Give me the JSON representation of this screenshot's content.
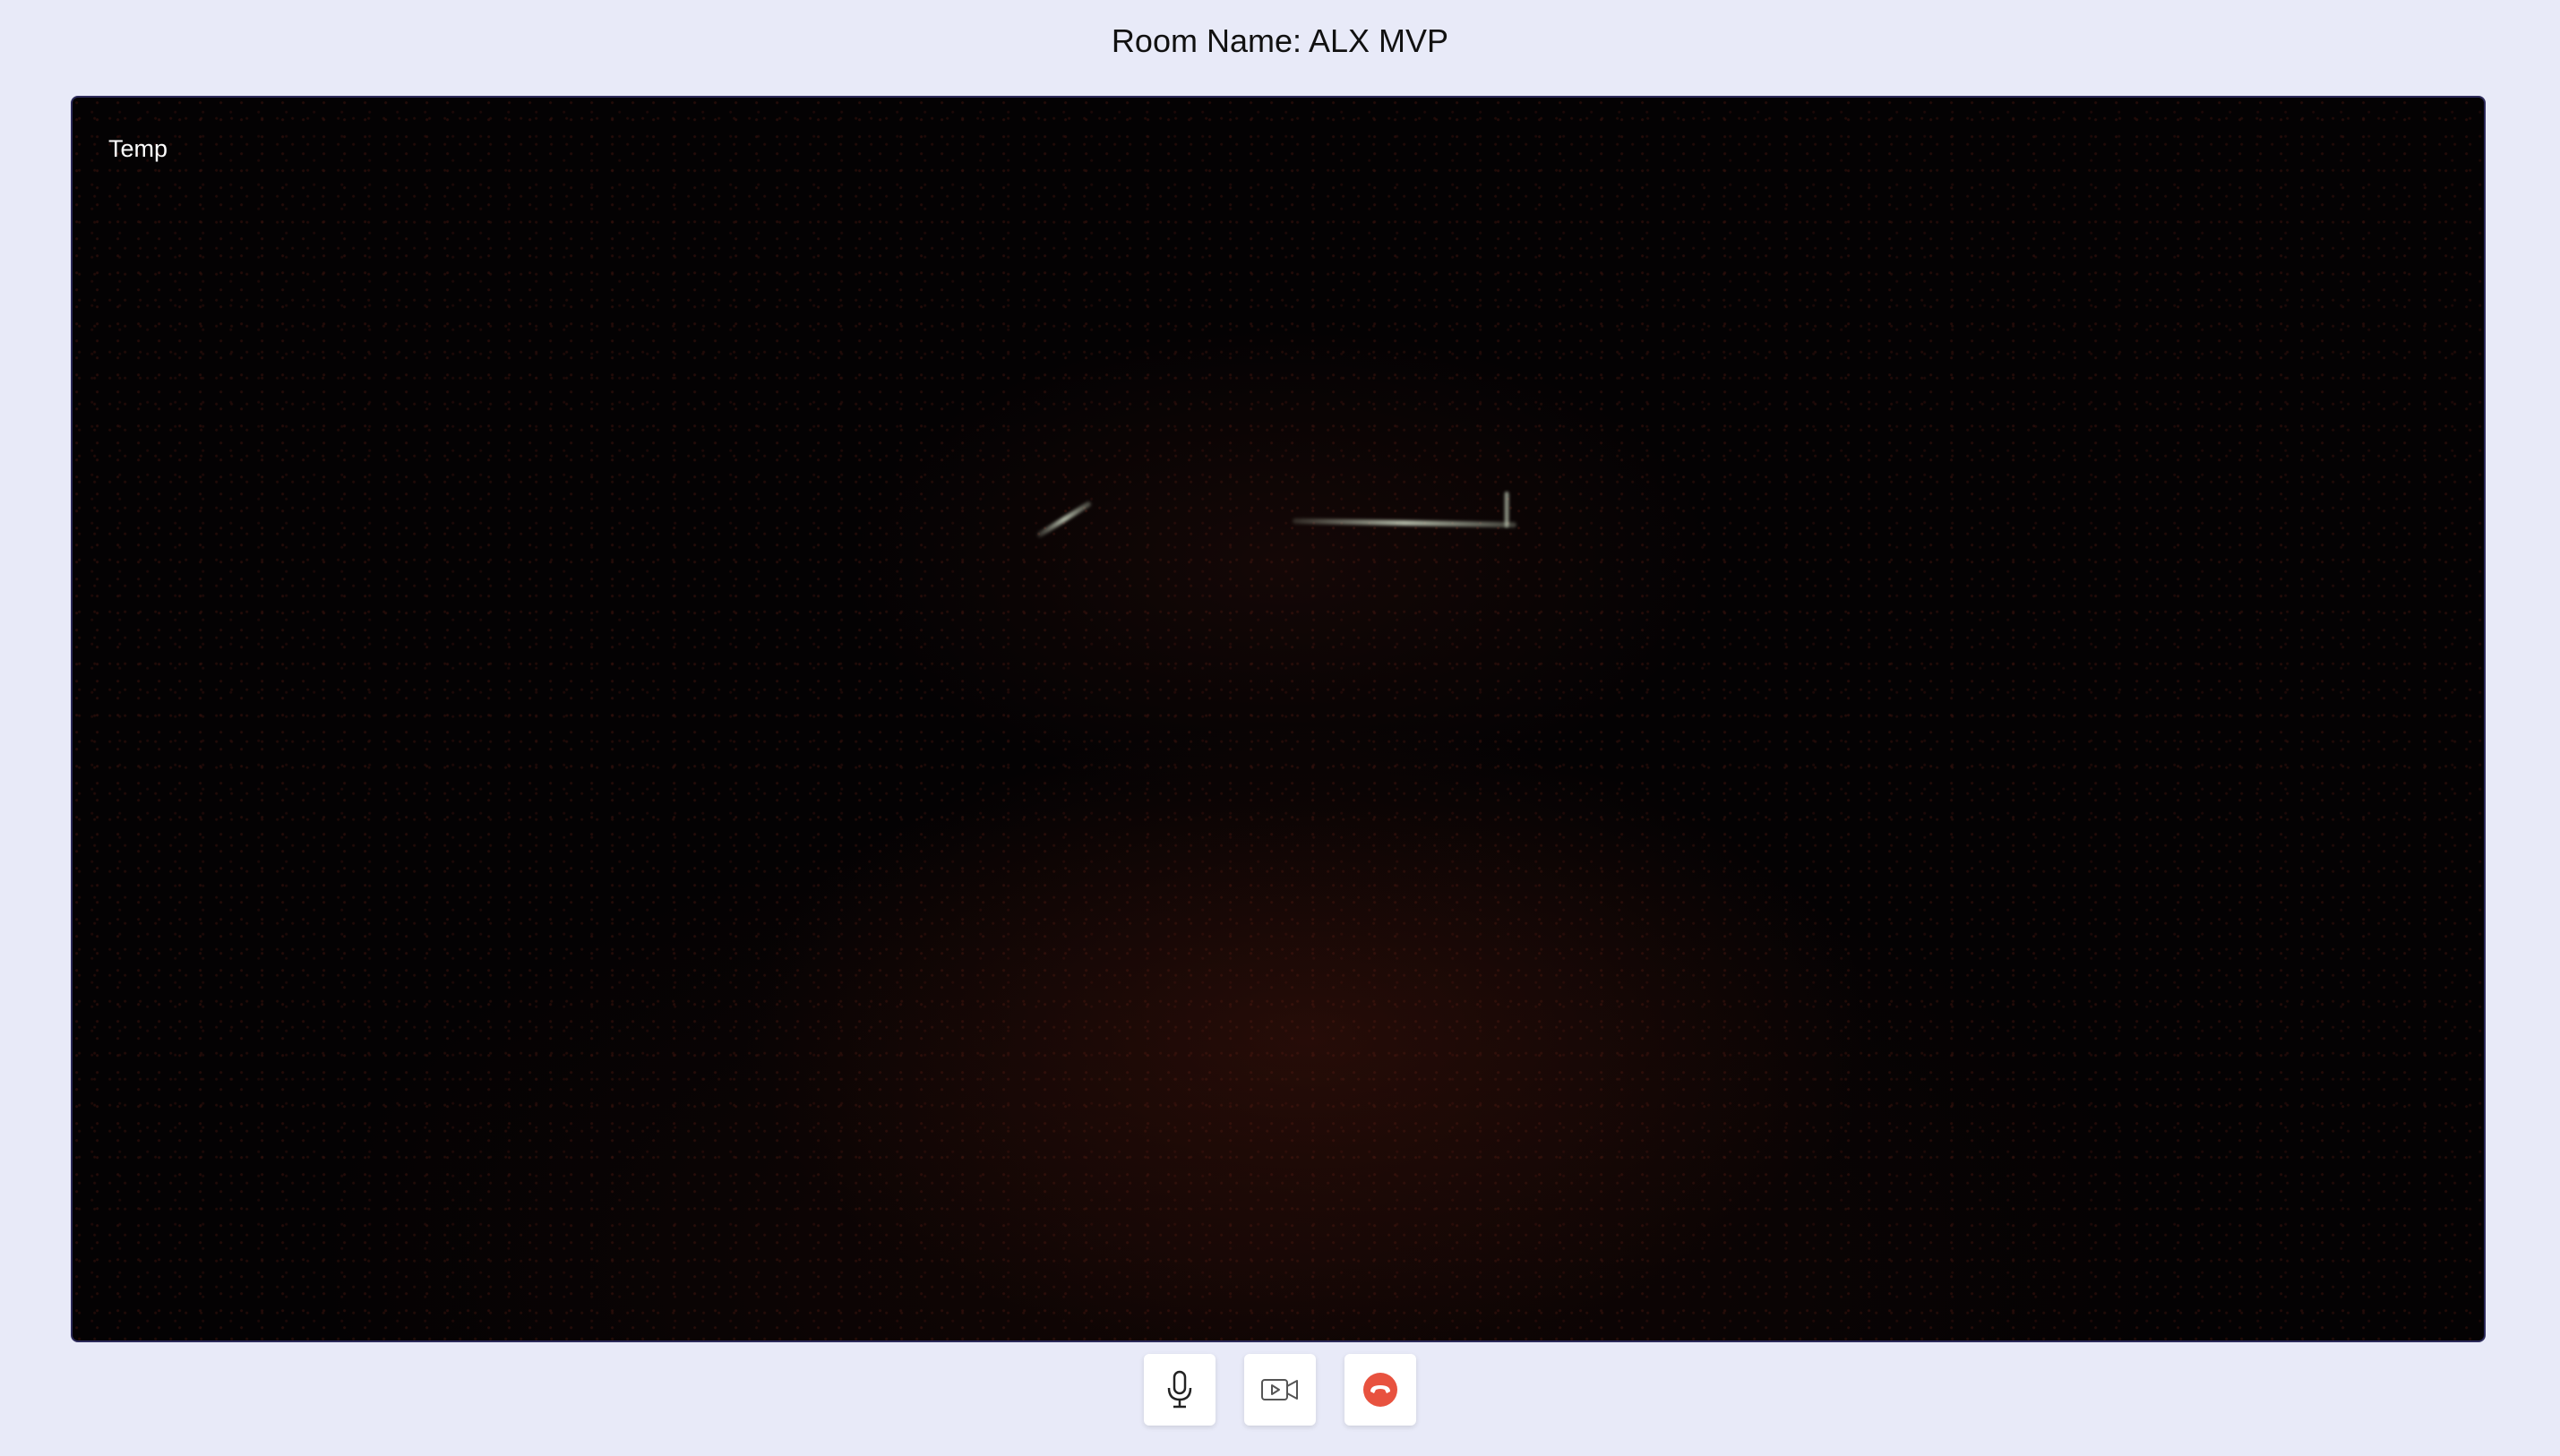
{
  "header": {
    "room_title": "Room Name: ALX MVP"
  },
  "video": {
    "participant_name": "Temp"
  },
  "controls": {
    "buttons": [
      {
        "icon": "microphone-icon",
        "action": "toggle-mic"
      },
      {
        "icon": "video-camera-icon",
        "action": "toggle-camera"
      },
      {
        "icon": "end-call-icon",
        "action": "hang-up",
        "color": "#e8523f"
      }
    ]
  },
  "colors": {
    "page_background": "#e8eaf8",
    "video_background": "#040203",
    "end_call": "#e8523f"
  }
}
